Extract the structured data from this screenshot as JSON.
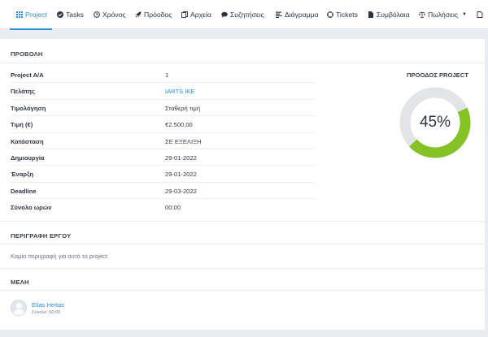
{
  "tabs": [
    {
      "label": "Project",
      "icon": "grid-icon",
      "active": true
    },
    {
      "label": "Tasks",
      "icon": "check-circle-icon"
    },
    {
      "label": "Χρόνος",
      "icon": "clock-icon"
    },
    {
      "label": "Πρόοδος",
      "icon": "rocket-icon"
    },
    {
      "label": "Αρχεία",
      "icon": "files-icon"
    },
    {
      "label": "Συζητήσεις",
      "icon": "comments-icon"
    },
    {
      "label": "Διάγραμμα",
      "icon": "gantt-icon"
    },
    {
      "label": "Tickets",
      "icon": "life-ring-icon"
    },
    {
      "label": "Συμβόλαια",
      "icon": "document-icon"
    },
    {
      "label": "Πωλήσεις",
      "icon": "balance-scale-icon",
      "dropdown": true
    },
    {
      "label": "",
      "icon": "file-icon"
    }
  ],
  "overview": {
    "title": "ΠΡΟΒΟΛΗ",
    "rows": [
      {
        "label": "Project A/A",
        "value": "1"
      },
      {
        "label": "Πελάτης",
        "value": "IARTS IKE",
        "link": true
      },
      {
        "label": "Τιμολόγηση",
        "value": "Σταθερή τιμή"
      },
      {
        "label": "Τιμή (€)",
        "value": "€2.500,00"
      },
      {
        "label": "Κατάσταση",
        "value": "ΣΕ ΕΞΕΛΙΞΗ"
      },
      {
        "label": "Δημιουργία",
        "value": "29-01-2022"
      },
      {
        "label": "Έναρξη",
        "value": "29-01-2022"
      },
      {
        "label": "Deadline",
        "value": "29-03-2022"
      },
      {
        "label": "Σύνολο ωρών",
        "value": "00:00"
      }
    ]
  },
  "progress": {
    "title": "ΠΡΟΟΔΟΣ PROJECT",
    "percent_label": "45%",
    "fraction": 0.45,
    "fill_color": "#84c225",
    "track_color": "#e3e4e6"
  },
  "description": {
    "title": "ΠΕΡΙΓΡΑΦΗ ΕΡΓΟΥ",
    "text": "Καμία περιγραφή για αυτό το project"
  },
  "members": {
    "title": "ΜΕΛΗ",
    "items": [
      {
        "name": "Elias Heitas",
        "sub": "Σύνολο: 00:00"
      }
    ]
  },
  "colors": {
    "accent": "#2a8fd4"
  }
}
